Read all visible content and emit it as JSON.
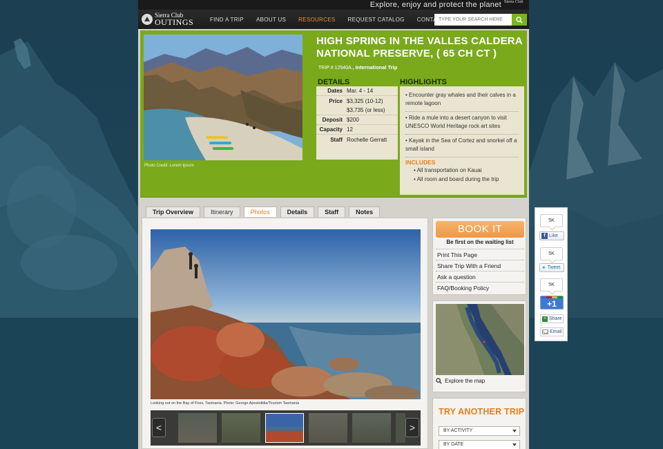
{
  "header": {
    "tagline": "Explore, enjoy and protect the planet",
    "sierra_club_mini": "Sierra Club",
    "logo_line1": "Sierra Club",
    "logo_line2": "OUTINGS",
    "nav": [
      {
        "label": "FIND A TRIP",
        "active": false
      },
      {
        "label": "ABOUT US",
        "active": false
      },
      {
        "label": "RESOURCES",
        "active": true
      },
      {
        "label": "REQUEST CATALOG",
        "active": false
      },
      {
        "label": "CONTACT US",
        "active": false
      }
    ],
    "search_placeholder": "TYPE YOUR SEARCH HERE"
  },
  "trip": {
    "title": "HIGH SPRING IN THE VALLES CALDERA NATIONAL PRESERVE, ( 65 CH CT )",
    "trip_number": "TRIP # 12540A",
    "trip_type": ", International Trip",
    "photo_credit": "Photo Credit: Lorem Ipsum",
    "details_heading": "DETAILS",
    "details": [
      {
        "key": "Dates",
        "value": "Mar. 4 - 14"
      },
      {
        "key": "Price",
        "value": "$3,325 (10-12)"
      },
      {
        "key": "",
        "value": "$3,735 (or less)"
      },
      {
        "key": "Deposit",
        "value": "$200"
      },
      {
        "key": "Capacity",
        "value": "12"
      },
      {
        "key": "Staff",
        "value": "Rochelle Gerratt"
      }
    ],
    "highlights_heading": "HIGHLIGHTS",
    "highlights": [
      "• Encounter gray whales and their calves in a remote lagoon",
      "• Ride a mule into a desert canyon to visit UNESCO World Heritage rock art sites",
      "• Kayak in the Sea of Cortez and snorkel off a small island"
    ],
    "includes_heading": "INCLUDES",
    "includes": [
      "• All transportation on Kauai",
      "• All room and board during the trip"
    ]
  },
  "tabs": [
    {
      "label": "Trip Overview",
      "active": false
    },
    {
      "label": "Itinerary",
      "active": false
    },
    {
      "label": "Photos",
      "active": true
    },
    {
      "label": "Details",
      "active": false
    },
    {
      "label": "Staff",
      "active": false
    },
    {
      "label": "Notes",
      "active": false
    }
  ],
  "photos": {
    "caption": "Looking out on the Bay of Fires, Tasmania. Photo: George Apostolidis/Tourism Tasmania",
    "prev_arrow": "<",
    "next_arrow": ">"
  },
  "sidebar": {
    "book_label": "BOOK IT",
    "waitlist": "Be first on the waiting list",
    "links": [
      "Print This Page",
      "Share Trip With a Friend",
      "Ask a question",
      "FAQ/Booking Policy"
    ],
    "explore_map": "Explore the map",
    "try_another": "TRY ANOTHER TRIP",
    "select_activity": "BY ACTIVITY",
    "select_date": "BY DATE"
  },
  "share": {
    "fb_count": "5K",
    "fb_label": "Like",
    "tw_count": "5K",
    "tw_label": "Tweet",
    "gp_count": "5K",
    "gp_label": "+1",
    "share_label": "Share",
    "email_label": "Email"
  },
  "colors": {
    "accent_orange": "#e97d1a",
    "hero_green": "#7aaa1c",
    "background_blue": "#1e4a5c"
  }
}
